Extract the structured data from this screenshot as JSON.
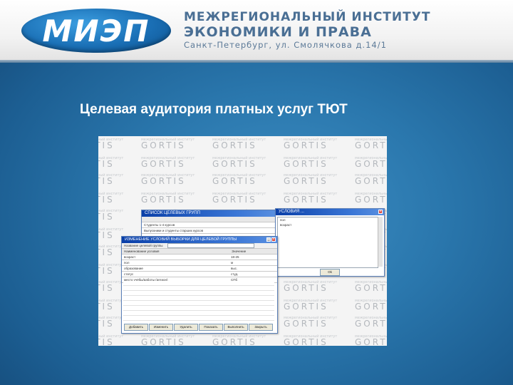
{
  "header": {
    "logo_text": "МИЭП",
    "institute_line1": "МЕЖРЕГИОНАЛЬНЫЙ ИНСТИТУТ",
    "institute_line2": "ЭКОНОМИКИ И ПРАВА",
    "address": "Санкт-Петербург, ул. Смолячкова д.14/1"
  },
  "slide": {
    "title": "Целевая аудитория платных услуг ТЮТ"
  },
  "screenshot": {
    "watermark_text": "GORTIS",
    "watermark_subtext": "межрегиональный институт",
    "window_target_groups": {
      "title": "СПИСОК ЦЕЛЕВЫХ ГРУПП",
      "rows": [
        "Студенты 1-4 курсов",
        "Выпускники и студенты старших курсов"
      ]
    },
    "window_conditions": {
      "title": "УСЛОВИЯ ...",
      "items": [
        "пол",
        "возраст"
      ],
      "button": "Ok"
    },
    "window_selection": {
      "title": "ИЗМЕНЕНИЕ УСЛОВИЙ ВЫБОРКИ ДЛЯ ЦЕЛЕВОЙ ГРУППЫ",
      "field_label": "Название целевой группы",
      "columns": [
        "Наименование условия",
        "Значение"
      ],
      "rows": [
        {
          "name": "возраст",
          "value": "18-25"
        },
        {
          "name": "пол",
          "value": "м"
        },
        {
          "name": "образование",
          "value": "выс."
        },
        {
          "name": "статус",
          "value": "студ."
        },
        {
          "name": "место учёбы/работы (регион)",
          "value": "СПб"
        }
      ],
      "buttons": [
        "Добавить",
        "Изменить",
        "Удалить",
        "Показать",
        "Выполнить",
        "Закрыть"
      ]
    }
  }
}
